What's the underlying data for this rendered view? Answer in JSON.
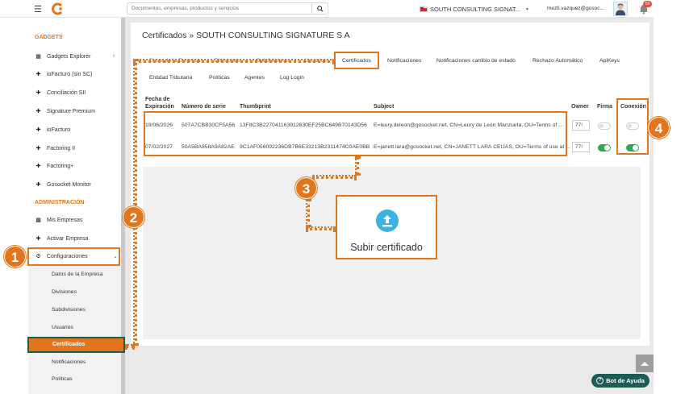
{
  "topbar": {
    "search_placeholder": "Documentos, empresas, productos y servicios",
    "company": "SOUTH CONSULTING SIGNAT...",
    "user_email": "mezti.vazquez@gosoc...",
    "notifications_count": "55"
  },
  "sidebar": {
    "gadgets_header": "GADGETS",
    "gadgets": [
      {
        "label": "Gadgets Explorer",
        "icon": "grid-icon"
      },
      {
        "label": "ioFacturo (sin SC)",
        "icon": "pin-icon"
      },
      {
        "label": "Conciliación SII",
        "icon": "pin-icon"
      },
      {
        "label": "Signature Premium",
        "icon": "pin-icon"
      },
      {
        "label": "ioFacturo",
        "icon": "pin-icon"
      },
      {
        "label": "Factoring II",
        "icon": "pin-icon"
      },
      {
        "label": "Factoring+",
        "icon": "pin-icon"
      },
      {
        "label": "Gosocket Monitor",
        "icon": "pin-icon"
      }
    ],
    "admin_header": "ADMINISTRACIÓN",
    "admin": [
      {
        "label": "Mis Empresas",
        "icon": "building-icon"
      },
      {
        "label": "Activar Empresa",
        "icon": "plus-icon"
      },
      {
        "label": "Configuraciones",
        "icon": "gears-icon"
      }
    ],
    "config_sub": [
      "Datos de la Empresa",
      "Divisiones",
      "Subdivisiones",
      "Usuarios",
      "Certificados",
      "Notificaciones",
      "Políticas"
    ]
  },
  "main": {
    "title": "Certificados",
    "title_sep": "»",
    "company": "SOUTH CONSULTING SIGNATURE S A",
    "tabs_row1": [
      "Datos de la Empresa",
      "Divisiones",
      "Subdivisiones",
      "Usuarios",
      "Certificados",
      "Notificaciones",
      "Notificaciones cambio de estado",
      "Rechazo Automático",
      "ApiKeys"
    ],
    "tabs_row2": [
      "Entidad Tributaria",
      "Políticas",
      "Agentes",
      "Log Login"
    ],
    "columns": {
      "fecha1": "Fecha de",
      "fecha2": "Expiración",
      "serie": "Número de serie",
      "thumb": "Thumbprint",
      "subject": "Subject",
      "owner": "Owner",
      "firma": "Firma",
      "conexion": "Conexión"
    },
    "rows": [
      {
        "fecha": "19/06/2026",
        "serie": "507A7CBB30CF5A56",
        "thumb": "13F8C3B227041163912630EF25BC649B70143D56",
        "subject": "E=leury.deleon@gosocket.net, CN=Leury de León Manzueta, OU=Terms of ...",
        "owner": "77!",
        "firma": false,
        "conexion": false
      },
      {
        "fecha": "07/02/2027",
        "serie": "50A5BA858A9A82AE",
        "thumb": "9C1AF056092236DB7B6E33213B2311474C0AE0BB",
        "subject": "E=janett.lara@gosocket.net, CN=JANETT LARA CEIJAS, OU=Terms of use at ...",
        "owner": "77!",
        "firma": true,
        "conexion": true
      }
    ],
    "upload_label": "Subir certificado"
  },
  "steps": [
    "1",
    "2",
    "3",
    "4"
  ],
  "help_bot": "Bot de Ayuda",
  "colors": {
    "accent": "#e2761c",
    "teal": "#1d5c55",
    "upload_blue": "#3bb2e0",
    "toggle_on": "#2ea84f"
  }
}
